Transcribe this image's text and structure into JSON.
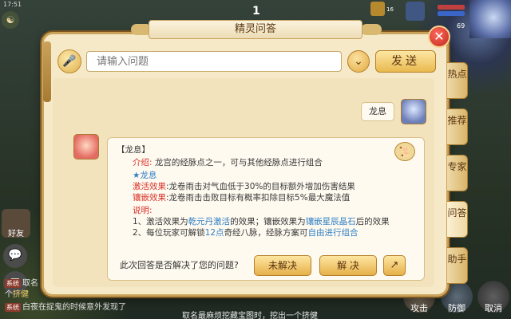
{
  "status_bar": {
    "time": "17:51"
  },
  "hud": {
    "top_number": "1",
    "top_count": "16",
    "level": "69"
  },
  "dialog": {
    "title": "精灵问答",
    "close_label": "✕",
    "input": {
      "placeholder": "请输入问题",
      "value": ""
    },
    "send_label": "发送",
    "dropdown_icon": "chevron-down",
    "tabs": [
      {
        "label": "热点"
      },
      {
        "label": "推荐"
      },
      {
        "label": "专家"
      },
      {
        "label": "问答"
      },
      {
        "label": "助手"
      }
    ],
    "user_question": "龙息",
    "answer": {
      "header": "【龙息】",
      "intro_label": "介绍:",
      "intro_text": "龙宫的经脉点之一，可与其他经脉点进行组合",
      "star_name": "★龙息",
      "activate_label": "激活效果",
      "activate_text": ":龙卷雨击对气血低于30%的目标额外增加伤害结果",
      "inlay_label": "镶嵌效果",
      "inlay_text": ":龙卷雨击击败目标有概率扣除目标5%最大魔法值",
      "note_label": "说明:",
      "note1_a": "1、激活效果为",
      "note1_b": "乾元丹激活",
      "note1_c": "的效果；镶嵌效果为",
      "note1_d": "镶嵌星辰晶石",
      "note1_e": "后的效果",
      "note2_a": "2、每位玩家可解锁",
      "note2_b": "12点",
      "note2_c": "奇经八脉，经脉方案可",
      "note2_d": "自由进行组合"
    },
    "resolved_question": "此次回答是否解决了您的问题?",
    "unresolved_label": "未解决",
    "resolved_label": "解 决"
  },
  "left_panel": {
    "friend_label": "好友"
  },
  "chat": {
    "line1_name": "取名",
    "line2_prefix": "个",
    "line2_name": "挤健",
    "line3": "白夜在捉鬼的时候意外发现了",
    "line4": "取名最麻烦挖藏宝图时，挖出一个挤健"
  },
  "actions": {
    "attack": "攻击",
    "defend": "防御",
    "cancel": "取消"
  }
}
